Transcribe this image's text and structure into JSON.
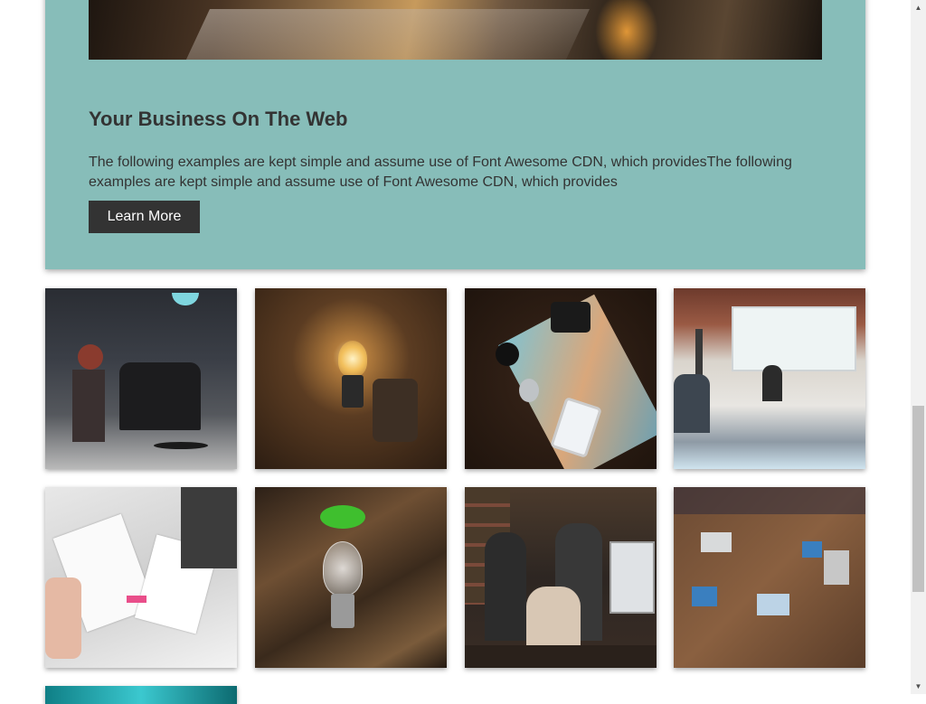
{
  "hero": {
    "title": "Your Business On The Web",
    "text": "The following examples are kept simple and assume use of Font Awesome CDN, which providesThe following examples are kept simple and assume use of Font Awesome CDN, which provides",
    "button_label": "Learn More",
    "image_icon": "workshop-photo"
  },
  "gallery": [
    {
      "icon": "barbershop-photo"
    },
    {
      "icon": "lightbulb-photo"
    },
    {
      "icon": "map-camera-watch-photo"
    },
    {
      "icon": "conference-presentation-photo"
    },
    {
      "icon": "design-planning-photo"
    },
    {
      "icon": "plant-bulb-photo"
    },
    {
      "icon": "business-team-photo"
    },
    {
      "icon": "team-laptops-photo"
    },
    {
      "icon": "teal-abstract-photo"
    }
  ],
  "colors": {
    "hero_background": "#87bdb9",
    "button_background": "#333333",
    "text": "#333333"
  },
  "scrollbar": {
    "up_icon": "scroll-up-arrow-icon",
    "down_icon": "scroll-down-arrow-icon"
  }
}
